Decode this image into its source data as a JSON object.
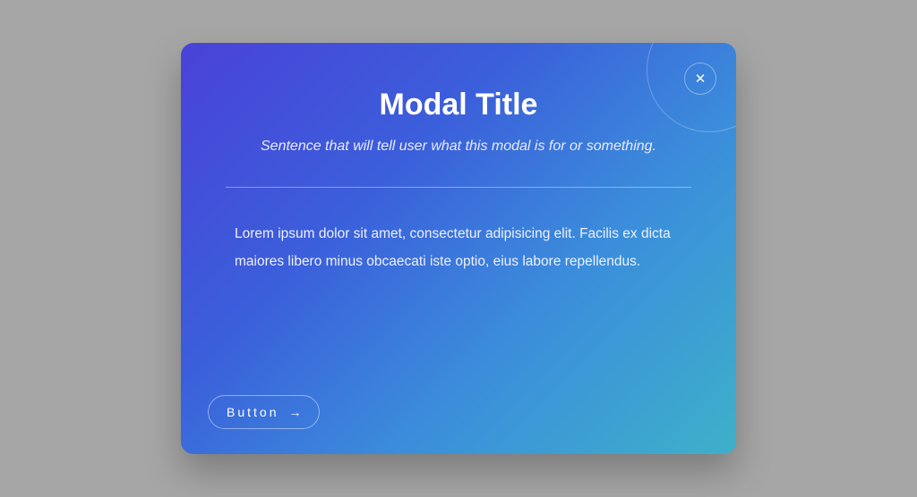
{
  "modal": {
    "title": "Modal Title",
    "subtitle": "Sentence that will tell user what this modal is for or something.",
    "body": "Lorem ipsum dolor sit amet, consectetur adipisicing elit. Facilis ex dicta maiores libero minus obcaecati iste optio, eius labore repellendus.",
    "close_symbol": "✕",
    "action_label": "Button",
    "action_arrow": "→"
  }
}
